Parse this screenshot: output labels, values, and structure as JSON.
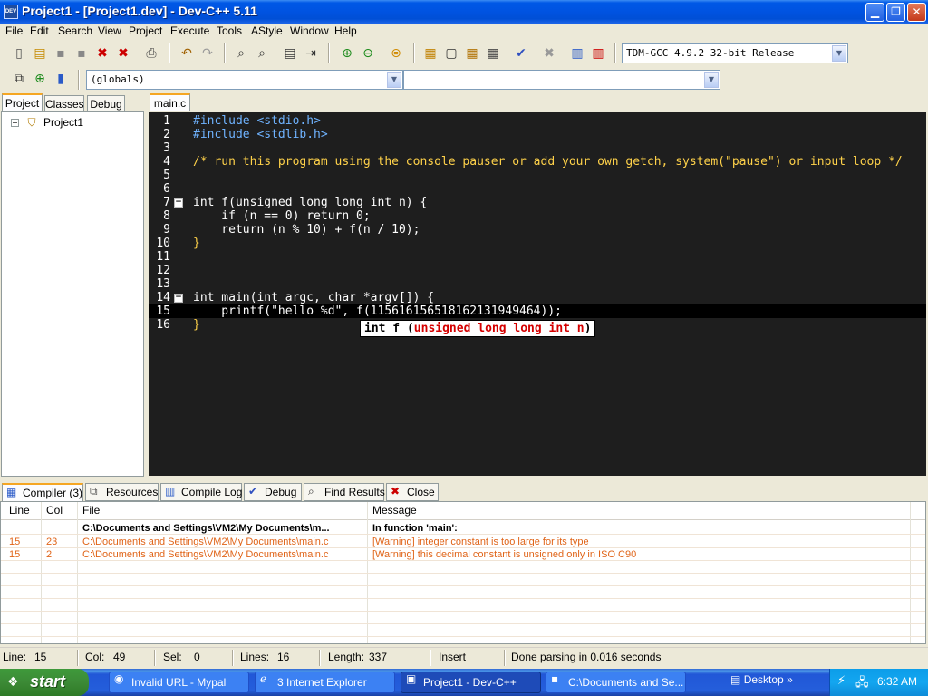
{
  "window": {
    "title": "Project1 - [Project1.dev] - Dev-C++ 5.11",
    "app_icon_text": "DEV",
    "minimize": "▁",
    "restore": "❐",
    "close": "✕"
  },
  "menu": [
    "File",
    "Edit",
    "Search",
    "View",
    "Project",
    "Execute",
    "Tools",
    "AStyle",
    "Window",
    "Help"
  ],
  "toolbar": {
    "compiler_select": "TDM-GCC 4.9.2 32-bit Release",
    "globals_select": "(globals)",
    "function_select": ""
  },
  "left_tabs": [
    "Project",
    "Classes",
    "Debug"
  ],
  "project_tree": {
    "expander": "+",
    "label": "Project1"
  },
  "editor_tab": "main.c",
  "code_lines": [
    {
      "n": "1",
      "text": "#include <stdio.h>"
    },
    {
      "n": "2",
      "text": "#include <stdlib.h>"
    },
    {
      "n": "3",
      "text": ""
    },
    {
      "n": "4",
      "text": "/* run this program using the console pauser or add your own getch, system(\"pause\") or input loop */"
    },
    {
      "n": "5",
      "text": ""
    },
    {
      "n": "6",
      "text": ""
    },
    {
      "n": "7",
      "text": "int f(unsigned long long int n) {"
    },
    {
      "n": "8",
      "text": "    if (n == 0) return 0;"
    },
    {
      "n": "9",
      "text": "    return (n % 10) + f(n / 10);"
    },
    {
      "n": "10",
      "text": "}"
    },
    {
      "n": "11",
      "text": ""
    },
    {
      "n": "12",
      "text": ""
    },
    {
      "n": "13",
      "text": ""
    },
    {
      "n": "14",
      "text": "int main(int argc, char *argv[]) {"
    },
    {
      "n": "15",
      "text": "    printf(\"hello %d\", f(115616156518162131949464));"
    },
    {
      "n": "16",
      "text": "}"
    }
  ],
  "tooltip": {
    "prefix": "int f (",
    "param": "unsigned long long int n",
    ")": ")",
    "suffix": ")"
  },
  "bottom_tabs": [
    "Compiler (3)",
    "Resources",
    "Compile Log",
    "Debug",
    "Find Results",
    "Close"
  ],
  "messages": {
    "headers": {
      "line": "Line",
      "col": "Col",
      "file": "File",
      "message": "Message"
    },
    "rows": [
      {
        "line": "",
        "col": "",
        "file": "C:\\Documents and Settings\\VM2\\My Documents\\m...",
        "message": "In function 'main':",
        "kind": "bold"
      },
      {
        "line": "15",
        "col": "23",
        "file": "C:\\Documents and Settings\\VM2\\My Documents\\main.c",
        "message": "[Warning] integer constant is too large for its type",
        "kind": "warn"
      },
      {
        "line": "15",
        "col": "2",
        "file": "C:\\Documents and Settings\\VM2\\My Documents\\main.c",
        "message": "[Warning] this decimal constant is unsigned only in ISO C90",
        "kind": "warn"
      }
    ]
  },
  "status": {
    "line_label": "Line:",
    "line": "15",
    "col_label": "Col:",
    "col": "49",
    "sel_label": "Sel:",
    "sel": "0",
    "lines_label": "Lines:",
    "lines": "16",
    "length_label": "Length:",
    "length": "337",
    "mode": "Insert",
    "message": "Done parsing in 0.016 seconds"
  },
  "taskbar": {
    "start": "start",
    "tasks": [
      "Invalid URL - Mypal",
      "3 Internet Explorer",
      "Project1 - Dev-C++",
      "C:\\Documents and Se..."
    ],
    "desktop": "Desktop",
    "chevron": "»",
    "clock": "6:32 AM"
  }
}
